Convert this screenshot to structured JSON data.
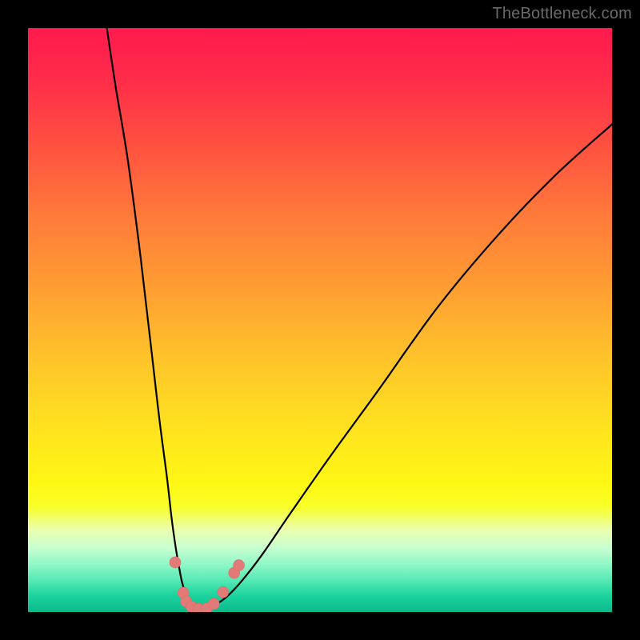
{
  "watermark": "TheBottleneck.com",
  "chart_data": {
    "type": "line",
    "title": "",
    "xlabel": "",
    "ylabel": "",
    "xlim": [
      0,
      100
    ],
    "ylim": [
      0,
      100
    ],
    "series": [
      {
        "name": "left-branch",
        "x": [
          13.5,
          15,
          17,
          19,
          21,
          22.5,
          23.8,
          24.6,
          25.3,
          25.9,
          26.4,
          26.9,
          27.3,
          27.8,
          28.4,
          29.1
        ],
        "y": [
          100,
          90,
          78,
          63,
          46,
          33,
          23,
          16,
          11,
          7.5,
          5,
          3.5,
          2.3,
          1.5,
          0.8,
          0.3
        ]
      },
      {
        "name": "right-branch",
        "x": [
          29.1,
          30.5,
          32,
          34,
          36.5,
          40,
          45,
          52,
          60,
          70,
          80,
          90,
          100
        ],
        "y": [
          0.3,
          0.6,
          1.2,
          2.6,
          5.2,
          9.7,
          17,
          27,
          38,
          52,
          64,
          74.5,
          83.5
        ]
      }
    ],
    "scatter_points": [
      {
        "x": 25.2,
        "y": 8.5
      },
      {
        "x": 26.6,
        "y": 3.3
      },
      {
        "x": 27.1,
        "y": 1.8
      },
      {
        "x": 28.0,
        "y": 0.9
      },
      {
        "x": 29.2,
        "y": 0.5
      },
      {
        "x": 30.6,
        "y": 0.6
      },
      {
        "x": 31.8,
        "y": 1.4
      },
      {
        "x": 33.4,
        "y": 3.4
      },
      {
        "x": 35.3,
        "y": 6.7
      },
      {
        "x": 36.1,
        "y": 8.0
      }
    ]
  }
}
